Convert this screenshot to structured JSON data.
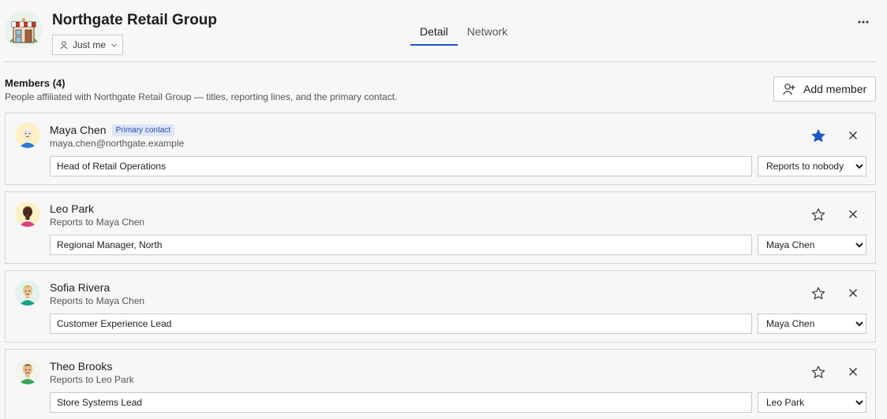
{
  "header": {
    "org_name": "Northgate Retail Group",
    "org_avatar_icon": "storefront-icon",
    "scope_label": "Just me",
    "tabs": [
      {
        "label": "Detail",
        "active": true
      },
      {
        "label": "Network",
        "active": false
      }
    ],
    "more_icon": "more-horizontal-icon"
  },
  "members_section": {
    "title": "Members (4)",
    "description": "People affiliated with Northgate Retail Group — titles, reporting lines, and the primary contact.",
    "add_button_label": "Add member"
  },
  "members": [
    {
      "name": "Maya Chen",
      "badge": "Primary contact",
      "subtitle": "maya.chen@northgate.example",
      "title_value": "Head of Retail Operations",
      "reports_to": "Reports to nobody",
      "starred": true,
      "avatar": {
        "bg": "#fdf0c4",
        "shirt": "#2d7dd2",
        "face": "#f6e6d6",
        "hair": "#ffffff"
      }
    },
    {
      "name": "Leo Park",
      "badge": "",
      "subtitle": "Reports to Maya Chen",
      "title_value": "Regional Manager, North",
      "reports_to": "Maya Chen",
      "starred": false,
      "avatar": {
        "bg": "#fdf0c4",
        "shirt": "#e03c7b",
        "face": "#4a2a1a",
        "hair": "#7a3b1e"
      }
    },
    {
      "name": "Sofia Rivera",
      "badge": "",
      "subtitle": "Reports to Maya Chen",
      "title_value": "Customer Experience Lead",
      "reports_to": "Maya Chen",
      "starred": false,
      "avatar": {
        "bg": "#e3f2ee",
        "shirt": "#1aa38a",
        "face": "#e8c493",
        "hair": "#c8a72a"
      }
    },
    {
      "name": "Theo Brooks",
      "badge": "",
      "subtitle": "Reports to Leo Park",
      "title_value": "Store Systems Lead",
      "reports_to": "Leo Park",
      "starred": false,
      "avatar": {
        "bg": "#f1f4ea",
        "shirt": "#3aa55a",
        "face": "#e8b98a",
        "hair": "#6b3c1c"
      }
    }
  ],
  "reports_options": [
    "Reports to nobody",
    "Maya Chen",
    "Leo Park",
    "Sofia Rivera",
    "Theo Brooks"
  ],
  "colors": {
    "accent": "#1f56c7",
    "star_filled": "#1f56c7",
    "badge_bg": "#dde6f7",
    "badge_text": "#2a4aa8"
  }
}
